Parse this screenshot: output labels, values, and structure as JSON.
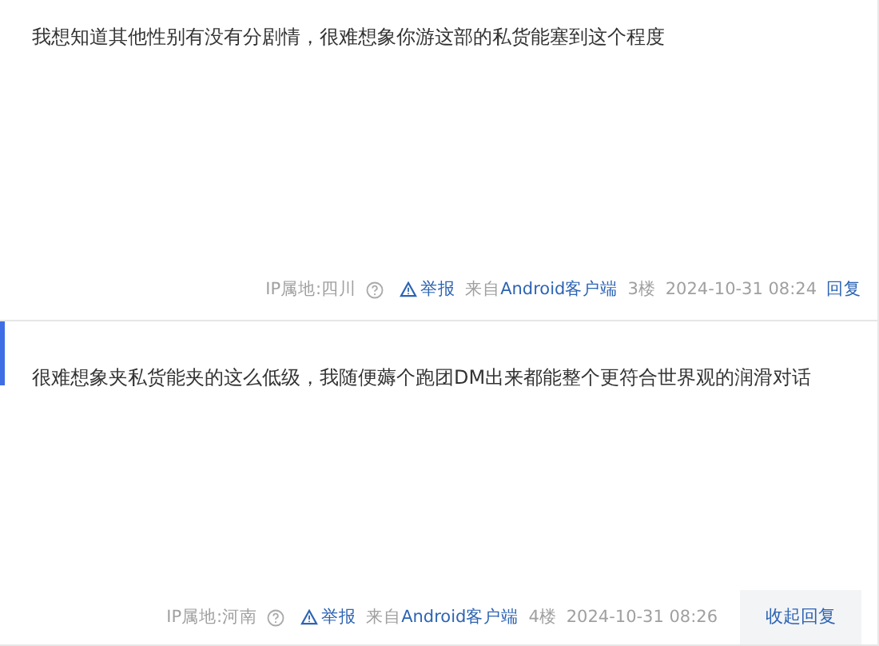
{
  "posts": [
    {
      "content": "我想知道其他性别有没有分剧情，很难想象你游这部的私货能塞到这个程度",
      "ip": "IP属地:四川",
      "report": "举报",
      "source_prefix": "来自",
      "source_client": "Android客户端",
      "floor": "3楼",
      "time": "2024-10-31 08:24",
      "action": "回复",
      "kind": "link",
      "highlighted": false
    },
    {
      "content": "很难想象夹私货能夹的这么低级，我随便薅个跑团DM出来都能整个更符合世界观的润滑对话",
      "ip": "IP属地:河南",
      "report": "举报",
      "source_prefix": "来自",
      "source_client": "Android客户端",
      "floor": "4楼",
      "time": "2024-10-31 08:26",
      "action": "收起回复",
      "kind": "button",
      "highlighted": true
    }
  ]
}
